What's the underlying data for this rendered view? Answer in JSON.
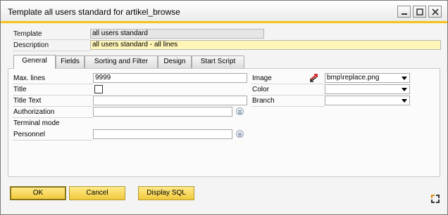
{
  "window": {
    "title": "Template all users standard for  artikel_browse"
  },
  "header": {
    "template_label": "Template",
    "template_value": "all users standard",
    "description_label": "Description",
    "description_value": "all users standard - all lines"
  },
  "tabs": [
    {
      "label": "General"
    },
    {
      "label": "Fields"
    },
    {
      "label": "Sorting and Filter"
    },
    {
      "label": "Design"
    },
    {
      "label": "Start Script"
    }
  ],
  "general": {
    "max_lines_label": "Max. lines",
    "max_lines_value": "9999",
    "title_label": "Title",
    "title_text_label": "Title Text",
    "authorization_label": "Authorization",
    "terminal_mode_label": "Terminal mode",
    "personnel_label": "Personnel",
    "image_label": "Image",
    "image_value": "bmp\\replace.png",
    "color_label": "Color",
    "branch_label": "Branch"
  },
  "buttons": {
    "ok_label": "OK",
    "cancel_label": "Cancel",
    "display_sql_label": "Display SQL"
  },
  "colors": {
    "accent": "#f5c21a",
    "description_bg": "#fff5b6",
    "button_bg": "#f0c93c"
  },
  "icons": {
    "window_controls": [
      "minimize-icon",
      "maximize-icon",
      "close-icon"
    ],
    "image_link": "link-arrows-icon",
    "lookup": "list-lookup-icon",
    "corner": "resize-corner-icon"
  }
}
